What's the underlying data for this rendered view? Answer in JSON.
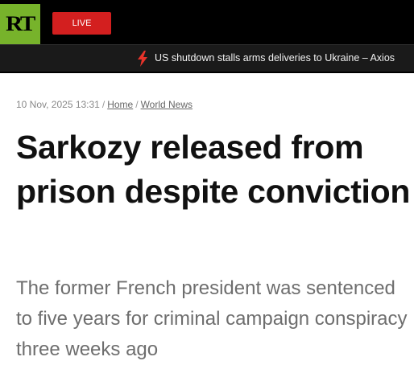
{
  "header": {
    "logo_text": "RT",
    "live_label": "LIVE",
    "ticker_icon": "lightning-bolt-icon",
    "ticker_text": "US shutdown stalls arms deliveries to Ukraine – Axios"
  },
  "breadcrumb": {
    "timestamp": "10 Nov, 2025 13:31",
    "separator": "/",
    "home": "Home",
    "section": "World News"
  },
  "article": {
    "title": "Sarkozy released from prison despite conviction",
    "summary": "The former French president was sentenced to five years for criminal campaign conspiracy three weeks ago"
  },
  "colors": {
    "brand_green": "#77b32b",
    "live_red": "#d31f1f",
    "header_bg": "#000000",
    "ticker_bg": "#1a1a1a",
    "bolt_red": "#e8332a"
  }
}
